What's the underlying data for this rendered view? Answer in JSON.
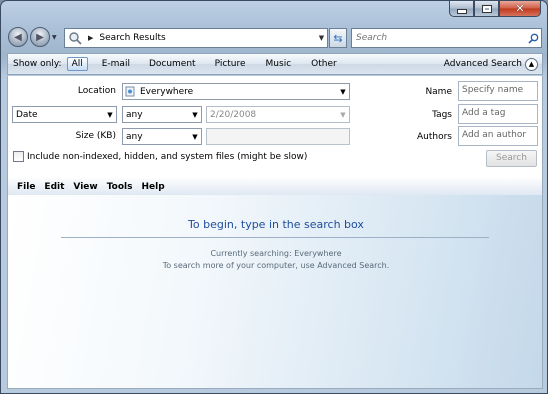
{
  "address_bar": {
    "path": "Search Results"
  },
  "search_box": {
    "placeholder": "Search"
  },
  "show_only": {
    "label": "Show only:",
    "tabs": [
      "All",
      "E-mail",
      "Document",
      "Picture",
      "Music",
      "Other"
    ],
    "active": "All",
    "advanced_label": "Advanced Search"
  },
  "advanced": {
    "location_label": "Location",
    "location_value": "Everywhere",
    "date_field": "Date",
    "date_op": "any",
    "date_value": "2/20/2008",
    "size_label": "Size (KB)",
    "size_op": "any",
    "name_label": "Name",
    "name_placeholder": "Specify name",
    "tags_label": "Tags",
    "tags_placeholder": "Add a tag",
    "authors_label": "Authors",
    "authors_placeholder": "Add an author",
    "include_label": "Include non-indexed, hidden, and system files (might be slow)",
    "search_button": "Search"
  },
  "menu": [
    "File",
    "Edit",
    "View",
    "Tools",
    "Help"
  ],
  "content": {
    "headline": "To begin, type in the search box",
    "line1": "Currently searching: Everywhere",
    "line2": "To search more of your computer, use Advanced Search."
  },
  "colors": {
    "headline": "#1e4d9c",
    "close_button": "#c0381b"
  }
}
